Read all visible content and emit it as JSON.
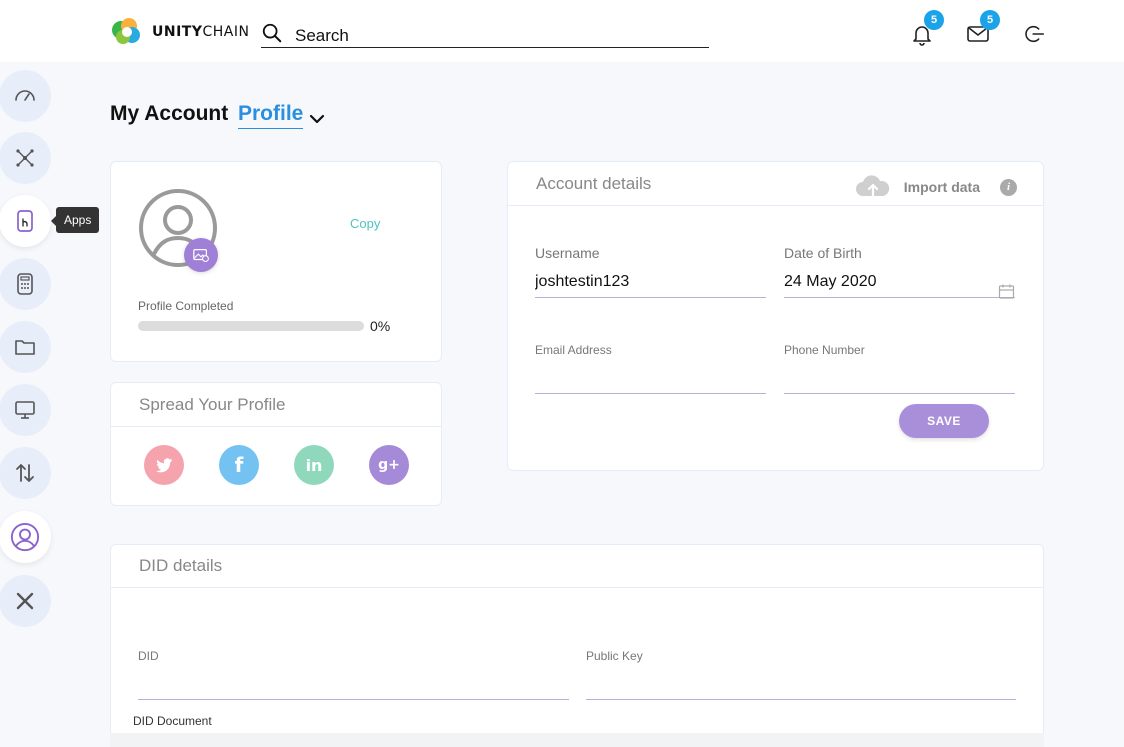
{
  "app": {
    "logo_bold": "UNITY",
    "logo_light": "CHAIN",
    "search_placeholder": "Search"
  },
  "header": {
    "notifications_count": "5",
    "messages_count": "5"
  },
  "sidebar": {
    "items": [
      {
        "name": "dashboard",
        "icon": "speedometer-icon"
      },
      {
        "name": "network",
        "icon": "network-icon"
      },
      {
        "name": "apps",
        "icon": "phone-app-icon",
        "tooltip": "Apps"
      },
      {
        "name": "calculator",
        "icon": "calculator-icon"
      },
      {
        "name": "folder",
        "icon": "folder-icon"
      },
      {
        "name": "monitor",
        "icon": "monitor-icon"
      },
      {
        "name": "transfer",
        "icon": "up-down-arrows-icon"
      },
      {
        "name": "profile",
        "icon": "user-circle-icon",
        "active": true
      },
      {
        "name": "close",
        "icon": "close-icon"
      }
    ]
  },
  "page": {
    "title": "My Account",
    "subtitle": "Profile"
  },
  "profile_card": {
    "copy_label": "Copy",
    "completed_label": "Profile Completed",
    "completed_percent": 0,
    "completed_text": "0%"
  },
  "spread_card": {
    "title": "Spread Your Profile",
    "socials": [
      {
        "name": "twitter",
        "color": "#f5a3ad"
      },
      {
        "name": "facebook",
        "color": "#74c2f2",
        "glyph": "f"
      },
      {
        "name": "linkedin",
        "color": "#8fd8bc",
        "glyph": "in"
      },
      {
        "name": "google-plus",
        "color": "#a58ad8",
        "glyph": "g+"
      }
    ]
  },
  "account_details": {
    "title": "Account details",
    "import_label": "Import data",
    "info_glyph": "i",
    "username_label": "Username",
    "username_value": "joshtestin123",
    "dob_label": "Date of Birth",
    "dob_value": "24 May 2020",
    "email_label": "Email Address",
    "email_value": "",
    "phone_label": "Phone Number",
    "phone_value": "",
    "save_label": "SAVE"
  },
  "did_details": {
    "title": "DID details",
    "did_label": "DID",
    "did_value": "",
    "public_key_label": "Public Key",
    "public_key_value": "",
    "document_label": "DID Document"
  },
  "colors": {
    "accent_blue": "#2b8fe0",
    "accent_purple": "#a07fd6",
    "copy_teal": "#4fc2c2",
    "badge_blue": "#1aa3e8"
  }
}
